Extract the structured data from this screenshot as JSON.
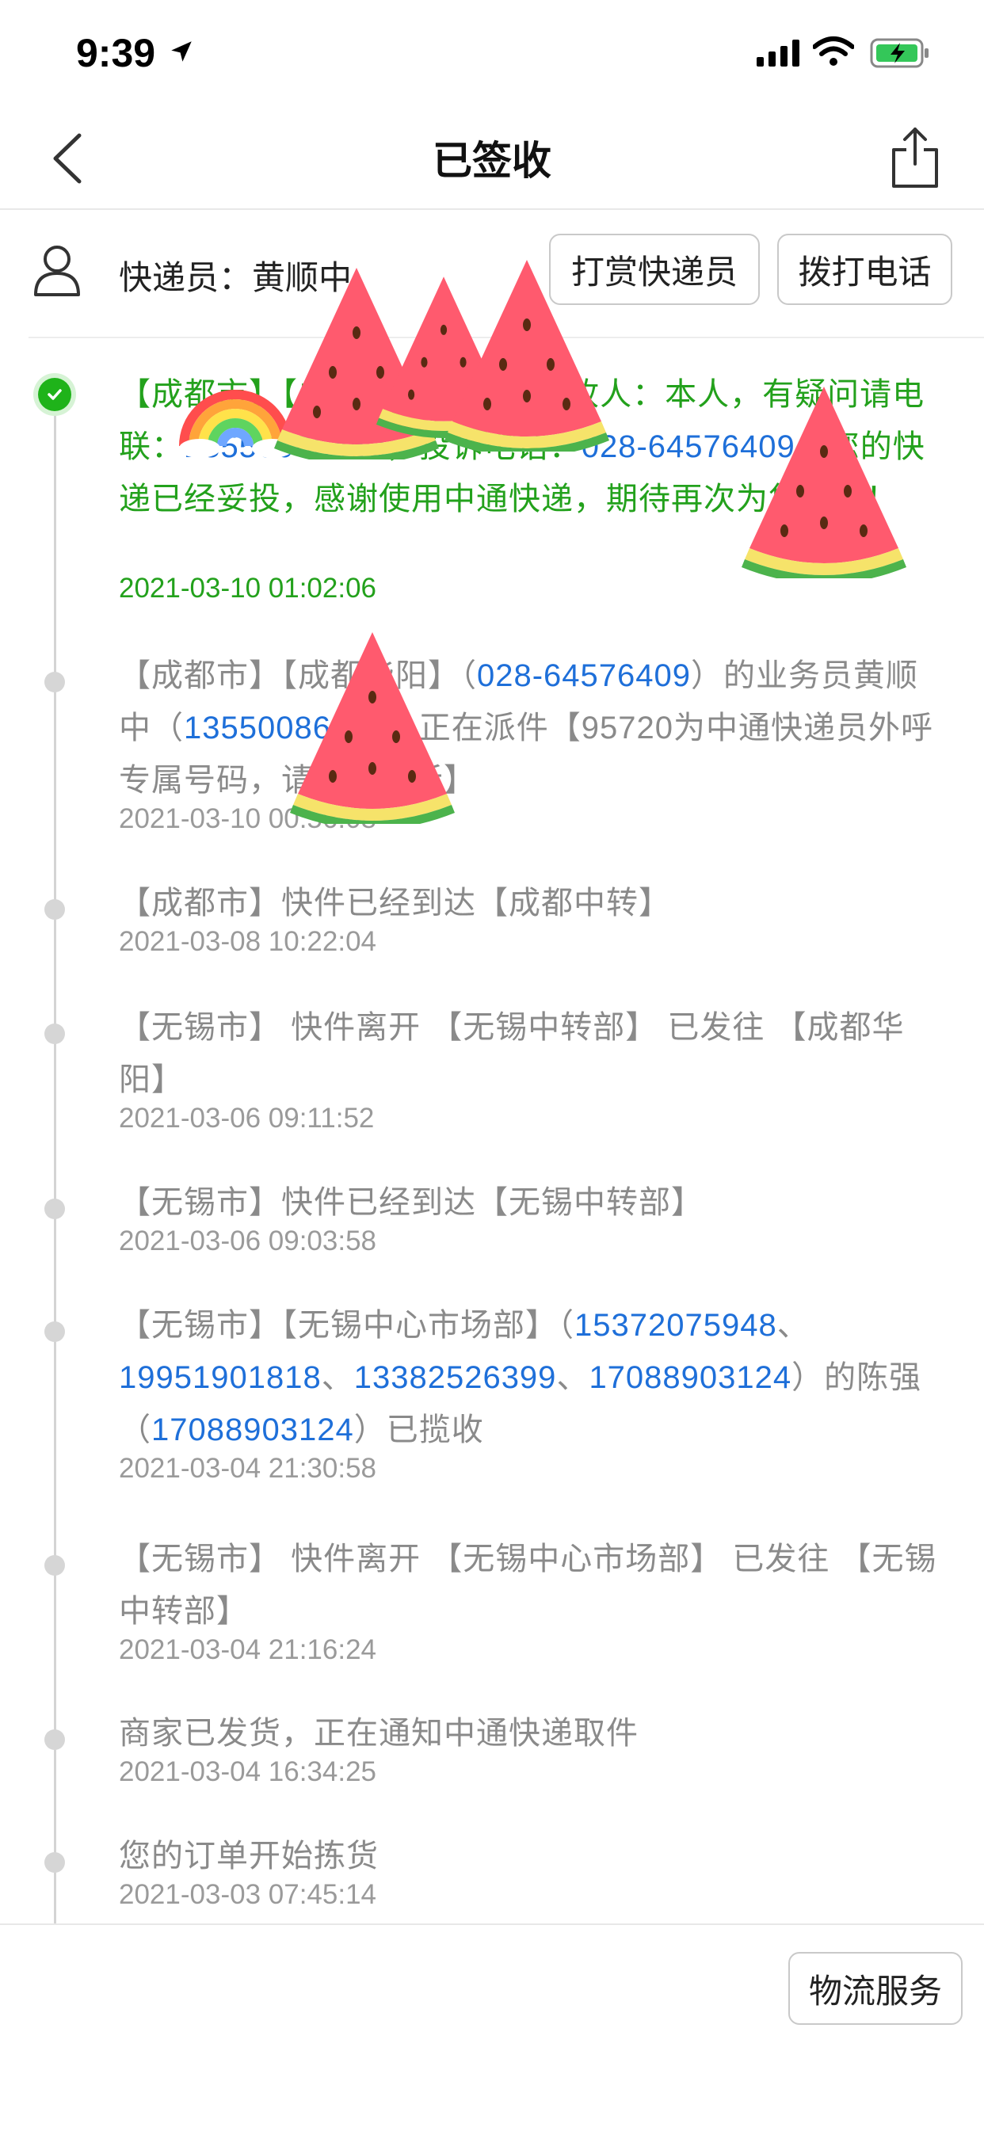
{
  "status_bar": {
    "time": "9:39"
  },
  "nav": {
    "title": "已签收"
  },
  "courier": {
    "label": "快递员：黄顺中",
    "tip_button": "打赏快递员",
    "call_button": "拨打电话"
  },
  "timeline": [
    {
      "parts": [
        "【成都市】【成都华阳】签收 签收人：本人，有疑问请电联：",
        "13550086453",
        "，投诉电话：",
        "028-64576409",
        "，您的快递已经妥投，感谢使用中通快递，期待再次为您服务！"
      ],
      "time": "2021-03-10 01:02:06"
    },
    {
      "parts": [
        "【成都市】【成都华阳】（",
        "028-64576409",
        "）的业务员黄顺中（",
        "13550086453",
        "）正在派件【95720为中通快递员外呼专属号码，请放心接听】"
      ],
      "time": "2021-03-10 00:56:08"
    },
    {
      "parts": [
        "【成都市】快件已经到达【成都中转】"
      ],
      "time": "2021-03-08 10:22:04"
    },
    {
      "parts": [
        "【无锡市】 快件离开 【无锡中转部】 已发往 【成都华阳】"
      ],
      "time": "2021-03-06 09:11:52"
    },
    {
      "parts": [
        "【无锡市】快件已经到达【无锡中转部】"
      ],
      "time": "2021-03-06 09:03:58"
    },
    {
      "parts": [
        "【无锡市】【无锡中心市场部】（",
        "15372075948",
        "、",
        "19951901818",
        "、",
        "13382526399",
        "、",
        "17088903124",
        "）的陈强（",
        "17088903124",
        "）已揽收"
      ],
      "time": "2021-03-04 21:30:58"
    },
    {
      "parts": [
        "【无锡市】 快件离开 【无锡中心市场部】 已发往 【无锡中转部】"
      ],
      "time": "2021-03-04 21:16:24"
    },
    {
      "parts": [
        "商家已发货，正在通知中通快递取件"
      ],
      "time": "2021-03-04 16:34:25"
    },
    {
      "parts": [
        "您的订单开始拣货"
      ],
      "time": "2021-03-03 07:45:14"
    }
  ],
  "bottom": {
    "service_button": "物流服务"
  },
  "colors": {
    "active": "#23a11c",
    "phone": "#1e6fd9",
    "muted": "#8a8a8a"
  }
}
